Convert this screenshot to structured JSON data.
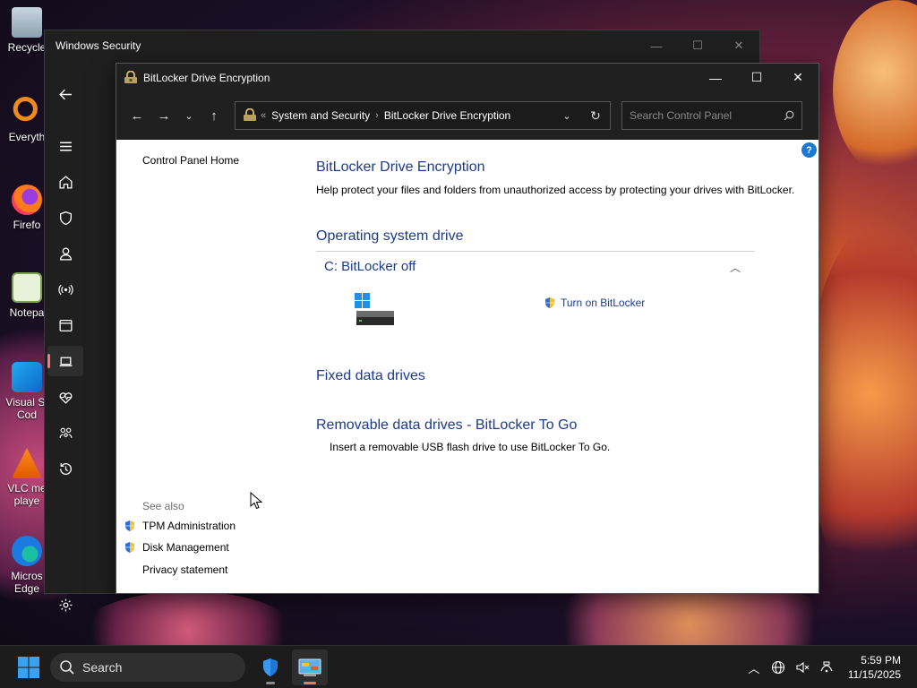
{
  "desktop": {
    "icons": [
      {
        "label": "Recycle"
      },
      {
        "label": "Everyth"
      },
      {
        "label": "Firefo"
      },
      {
        "label": "Notepa"
      },
      {
        "label": "Visual St"
      },
      {
        "label": "Cod"
      },
      {
        "label": "VLC me"
      },
      {
        "label": "playe"
      },
      {
        "label": "Micros"
      },
      {
        "label": "Edge"
      }
    ]
  },
  "windows_security": {
    "title": "Windows Security",
    "minimize": "—",
    "maximize": "☐",
    "close": "✕",
    "rail": [
      "back-icon",
      "menu-icon",
      "home-icon",
      "shield-icon",
      "person-icon",
      "antenna-icon",
      "app-window-icon",
      "laptop-icon",
      "heart-pulse-icon",
      "family-icon",
      "history-icon",
      "gear-icon"
    ]
  },
  "bitlocker_window": {
    "title": "BitLocker Drive Encryption",
    "minimize": "—",
    "maximize": "☐",
    "close": "✕",
    "nav": {
      "back": "←",
      "forward": "→",
      "recent": "⌄",
      "up": "↑"
    },
    "address": {
      "prefix": "«",
      "crumb1": "System and Security",
      "sep": "›",
      "crumb2": "BitLocker Drive Encryption",
      "dropdown": "⌄",
      "refresh": "↻"
    },
    "search": {
      "placeholder": "Search Control Panel"
    },
    "help": "?",
    "left_pane": {
      "home_link": "Control Panel Home",
      "see_also": "See also",
      "links": [
        "TPM Administration",
        "Disk Management",
        "Privacy statement"
      ]
    },
    "main": {
      "heading": "BitLocker Drive Encryption",
      "description": "Help protect your files and folders from unauthorized access by protecting your drives with BitLocker.",
      "os_section": "Operating system drive",
      "drive_label": "C: BitLocker off",
      "collapse": "︿",
      "turn_on": "Turn on BitLocker",
      "fixed_section": "Fixed data drives",
      "removable_section": "Removable data drives - BitLocker To Go",
      "removable_desc": "Insert a removable USB flash drive to use BitLocker To Go."
    }
  },
  "taskbar": {
    "search_label": "Search",
    "tray": {
      "chevron": "︿",
      "time": "5:59 PM",
      "date": "11/15/2025"
    }
  },
  "colors": {
    "link_blue": "#1c3b8c",
    "accent": "#ef7a84",
    "taskbar": "#1c1c1c"
  }
}
